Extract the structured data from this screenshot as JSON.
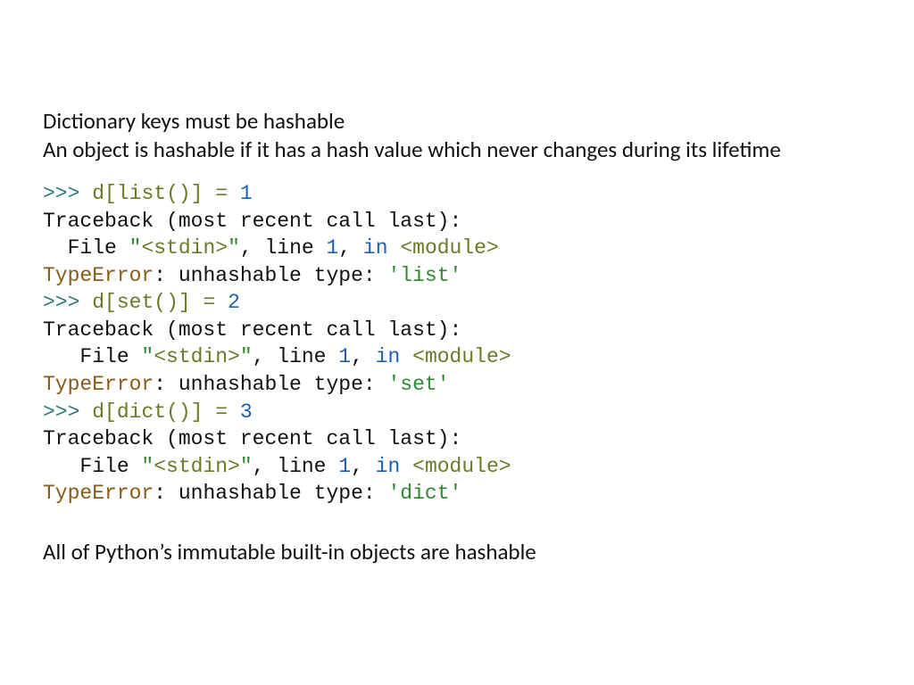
{
  "intro": {
    "line1": "Dictionary keys must be hashable",
    "line2": "An object is hashable if it has a hash value which never changes during its lifetime"
  },
  "code": {
    "prompt": ">>> ",
    "d": "d",
    "lbr": "[",
    "rbr": "]",
    "list": "list",
    "set": "set",
    "dict": "dict",
    "parens": "()",
    "assign": " = ",
    "one": "1",
    "two": "2",
    "three": "3",
    "traceback": "Traceback (most recent call last):",
    "file_head": "  File ",
    "file_head2": "   File ",
    "stdin_q1": "\"",
    "stdin": "<stdin>",
    "stdin_q2": "\"",
    "after_stdin_a": ", line ",
    "line_no": "1",
    "after_stdin_b": ", ",
    "in_kw": "in",
    "sp": " ",
    "module": "<module>",
    "TypeError": "TypeError",
    "colon_unhashable": ": unhashable type: ",
    "q": "'",
    "type_list": "list",
    "type_set": "set",
    "type_dict": "dict"
  },
  "outro": {
    "line1": "All of Python’s immutable built-in objects are hashable"
  }
}
